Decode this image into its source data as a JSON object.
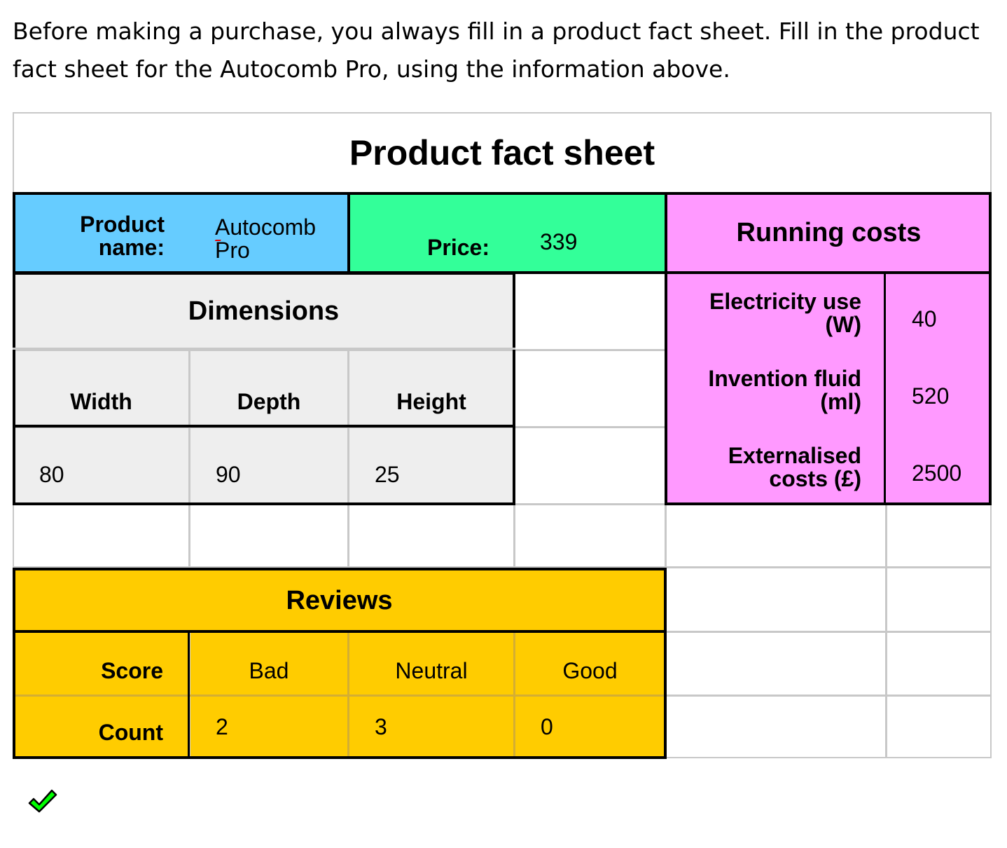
{
  "instructions": "Before making a purchase, you always fill in a product fact sheet. Fill in the product fact sheet for the Autocomb Pro, using the information above.",
  "sheet": {
    "title": "Product fact sheet",
    "product": {
      "label": "Product name:",
      "value": "Autocomb Pro"
    },
    "price": {
      "label": "Price:",
      "value": "339"
    },
    "running_costs": {
      "header": "Running costs",
      "rows": [
        {
          "label": "Electricity use (W)",
          "value": "40"
        },
        {
          "label": "Invention fluid (ml)",
          "value": "520"
        },
        {
          "label": "Externalised costs (£)",
          "value": "2500"
        }
      ]
    },
    "dimensions": {
      "header": "Dimensions",
      "columns": [
        "Width",
        "Depth",
        "Height"
      ],
      "values": [
        "80",
        "90",
        "25"
      ]
    },
    "reviews": {
      "header": "Reviews",
      "score_label": "Score",
      "count_label": "Count",
      "scores": [
        "Bad",
        "Neutral",
        "Good"
      ],
      "counts": [
        "2",
        "3",
        "0"
      ]
    }
  },
  "status": {
    "icon": "checkmark-icon",
    "color": "#00ff00"
  },
  "colors": {
    "product": "#66ccff",
    "price": "#33ff99",
    "running_costs": "#ff99ff",
    "dimensions": "#eeeeee",
    "reviews": "#ffcc00"
  }
}
